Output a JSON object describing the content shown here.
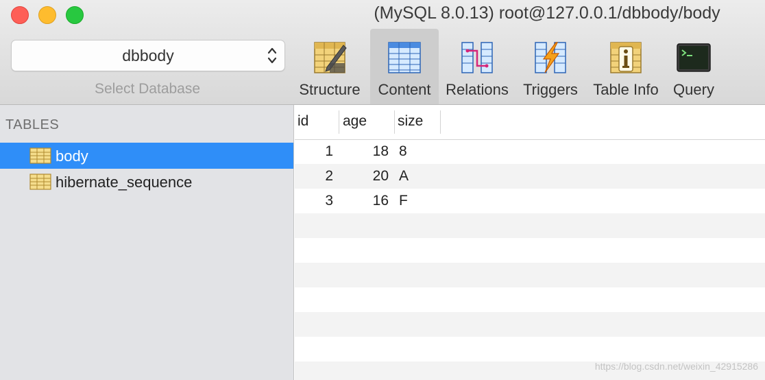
{
  "window": {
    "title": "(MySQL 8.0.13) root@127.0.0.1/dbbody/body"
  },
  "database_selector": {
    "value": "dbbody",
    "caption": "Select Database"
  },
  "toolbar": {
    "items": [
      {
        "label": "Structure",
        "icon": "structure-icon"
      },
      {
        "label": "Content",
        "icon": "content-icon",
        "active": true
      },
      {
        "label": "Relations",
        "icon": "relations-icon"
      },
      {
        "label": "Triggers",
        "icon": "triggers-icon"
      },
      {
        "label": "Table Info",
        "icon": "table-info-icon"
      },
      {
        "label": "Query",
        "icon": "query-icon"
      }
    ]
  },
  "sidebar": {
    "header": "TABLES",
    "tables": [
      {
        "label": "body",
        "selected": true
      },
      {
        "label": "hibernate_sequence",
        "selected": false
      }
    ]
  },
  "grid": {
    "columns": [
      "id",
      "age",
      "size"
    ],
    "rows": [
      [
        "1",
        "18",
        "8"
      ],
      [
        "2",
        "20",
        "A"
      ],
      [
        "3",
        "16",
        "F"
      ]
    ]
  },
  "watermark": "https://blog.csdn.net/weixin_42915286",
  "colors": {
    "selection": "#2f8ef8",
    "sidebar_bg": "#e2e3e6",
    "close": "#fe5f57",
    "minimize": "#febc2e",
    "maximize": "#28c840"
  }
}
